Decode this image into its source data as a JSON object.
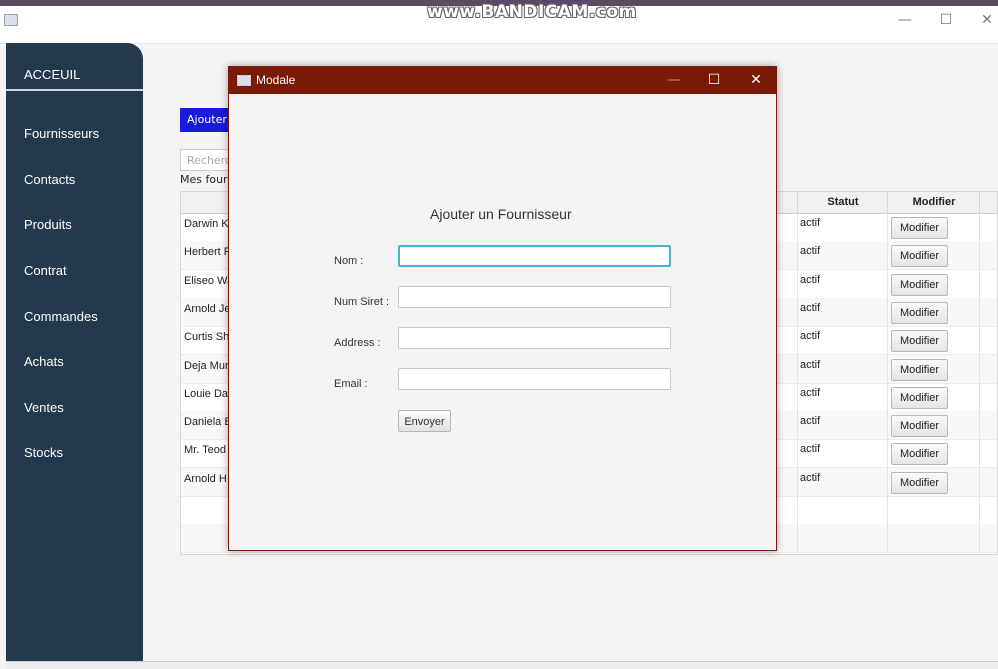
{
  "watermark": "www.BANDICAM.com",
  "window": {
    "minimize": "—",
    "maximize": "☐",
    "close": "✕"
  },
  "sidebar": {
    "home": "ACCEUIL",
    "items": [
      "Fournisseurs",
      "Contacts",
      "Produits",
      "Contrat",
      "Commandes",
      "Achats",
      "Ventes",
      "Stocks"
    ]
  },
  "content": {
    "add_button": "Ajouter f",
    "search_placeholder": "Recherch",
    "list_label": "Mes fourn"
  },
  "table": {
    "headers": {
      "statut": "Statut",
      "modifier": "Modifier"
    },
    "rows": [
      {
        "name": "Darwin K",
        "statut": "actif",
        "action": "Modifier"
      },
      {
        "name": "Herbert R",
        "statut": "actif",
        "action": "Modifier"
      },
      {
        "name": "Eliseo Wa",
        "statut": "actif",
        "action": "Modifier"
      },
      {
        "name": "Arnold Je",
        "statut": "actif",
        "action": "Modifier"
      },
      {
        "name": "Curtis Shi",
        "statut": "actif",
        "action": "Modifier"
      },
      {
        "name": "Deja Mur",
        "statut": "actif",
        "action": "Modifier"
      },
      {
        "name": "Louie Dar",
        "statut": "actif",
        "action": "Modifier"
      },
      {
        "name": "Daniela B",
        "statut": "actif",
        "action": "Modifier"
      },
      {
        "name": "Mr. Teod",
        "statut": "actif",
        "action": "Modifier"
      },
      {
        "name": "Arnold H",
        "statut": "actif",
        "action": "Modifier"
      }
    ]
  },
  "modal": {
    "title": "Modale",
    "minimize": "—",
    "maximize": "☐",
    "close": "✕",
    "heading": "Ajouter un Fournisseur",
    "fields": {
      "nom": {
        "label": "Nom :",
        "value": ""
      },
      "siret": {
        "label": "Num Siret :",
        "value": ""
      },
      "address": {
        "label": "Address :",
        "value": ""
      },
      "email": {
        "label": "Email :",
        "value": ""
      }
    },
    "submit": "Envoyer"
  }
}
